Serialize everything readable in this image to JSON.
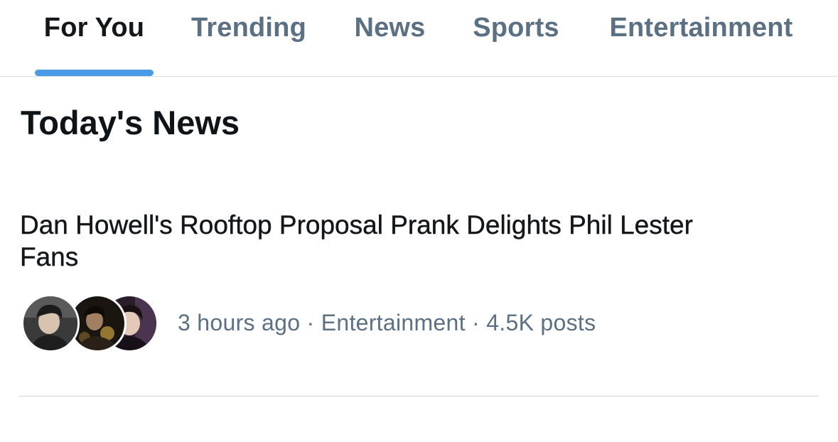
{
  "tabs": [
    {
      "label": "For You",
      "active": true
    },
    {
      "label": "Trending",
      "active": false
    },
    {
      "label": "News",
      "active": false
    },
    {
      "label": "Sports",
      "active": false
    },
    {
      "label": "Entertainment",
      "active": false
    }
  ],
  "colors": {
    "accent": "#4a9ae6",
    "text_primary": "#14171a",
    "text_secondary": "#5b7083",
    "divider": "#ccd6dd"
  },
  "section": {
    "title": "Today's News"
  },
  "news_item": {
    "headline": "Dan Howell's Rooftop Proposal Prank Delights Phil Lester Fans",
    "time": "3 hours ago",
    "separator": "·",
    "category": "Entertainment",
    "posts": "4.5K posts",
    "avatars": [
      "avatar-photo-1",
      "avatar-photo-2",
      "avatar-photo-3"
    ]
  }
}
